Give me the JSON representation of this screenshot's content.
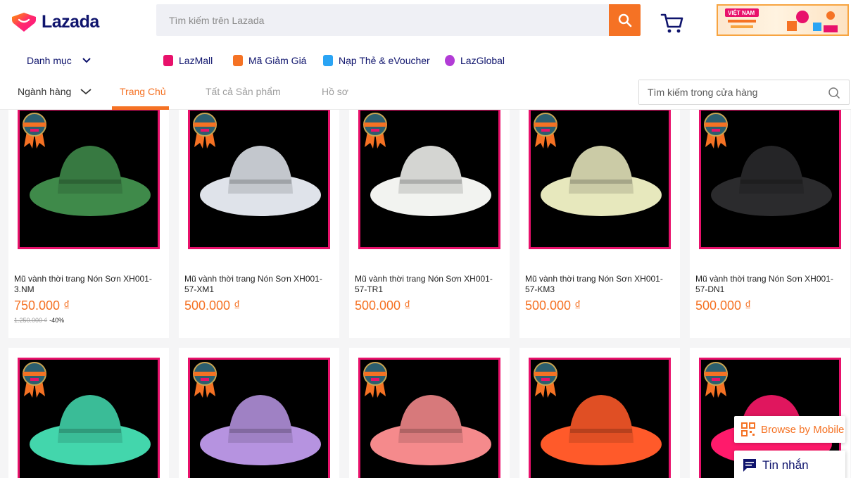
{
  "header": {
    "logo_text": "Lazada",
    "search_placeholder": "Tìm kiếm trên Lazada",
    "brand_color": "#f57224",
    "banner_text": "VIỆT NAM"
  },
  "category_nav": {
    "menu_label": "Danh mục",
    "links": [
      {
        "label": "LazMall",
        "icon": "lazmall-icon",
        "color": "#e8116b"
      },
      {
        "label": "Mã Giảm Giá",
        "icon": "voucher-icon",
        "color": "#f57224"
      },
      {
        "label": "Nạp Thẻ & eVoucher",
        "icon": "phone-card-icon",
        "color": "#2aa4f4"
      },
      {
        "label": "LazGlobal",
        "icon": "lazglobal-icon",
        "color": "#b23cd6"
      }
    ]
  },
  "store_nav": {
    "industry_label": "Ngành hàng",
    "tabs": [
      {
        "label": "Trang Chủ",
        "active": true
      },
      {
        "label": "Tất cả Sản phẩm",
        "active": false
      },
      {
        "label": "Hồ sơ",
        "active": false
      }
    ],
    "store_search_placeholder": "Tìm kiếm trong cửa hàng"
  },
  "products": [
    {
      "name": "Mũ vành thời trang Nón Sơn XH001-3.NM",
      "price": "750.000 ₫",
      "old_price": "1.250.000 ₫",
      "discount": "-40%",
      "color": "#3f8a4a"
    },
    {
      "name": "Mũ vành thời trang Nón Sơn XH001-57-XM1",
      "price": "500.000 ₫",
      "color": "#dfe3ea"
    },
    {
      "name": "Mũ vành thời trang Nón Sơn XH001-57-TR1",
      "price": "500.000 ₫",
      "color": "#f2f3f0"
    },
    {
      "name": "Mũ vành thời trang Nón Sơn XH001-57-KM3",
      "price": "500.000 ₫",
      "color": "#e7e8bd"
    },
    {
      "name": "Mũ vành thời trang Nón Sơn XH001-57-DN1",
      "price": "500.000 ₫",
      "color": "#2b2b2d"
    },
    {
      "name": "",
      "price": "",
      "color": "#43d6ac"
    },
    {
      "name": "",
      "price": "",
      "color": "#b693e0"
    },
    {
      "name": "",
      "price": "",
      "color": "#f58a8c"
    },
    {
      "name": "",
      "price": "",
      "color": "#ff5a2a"
    },
    {
      "name": "",
      "price": "",
      "color": "#ff1a6b"
    }
  ],
  "floating": {
    "mobile_label": "Browse by Mobile",
    "chat_label": "Tin nhắn"
  }
}
